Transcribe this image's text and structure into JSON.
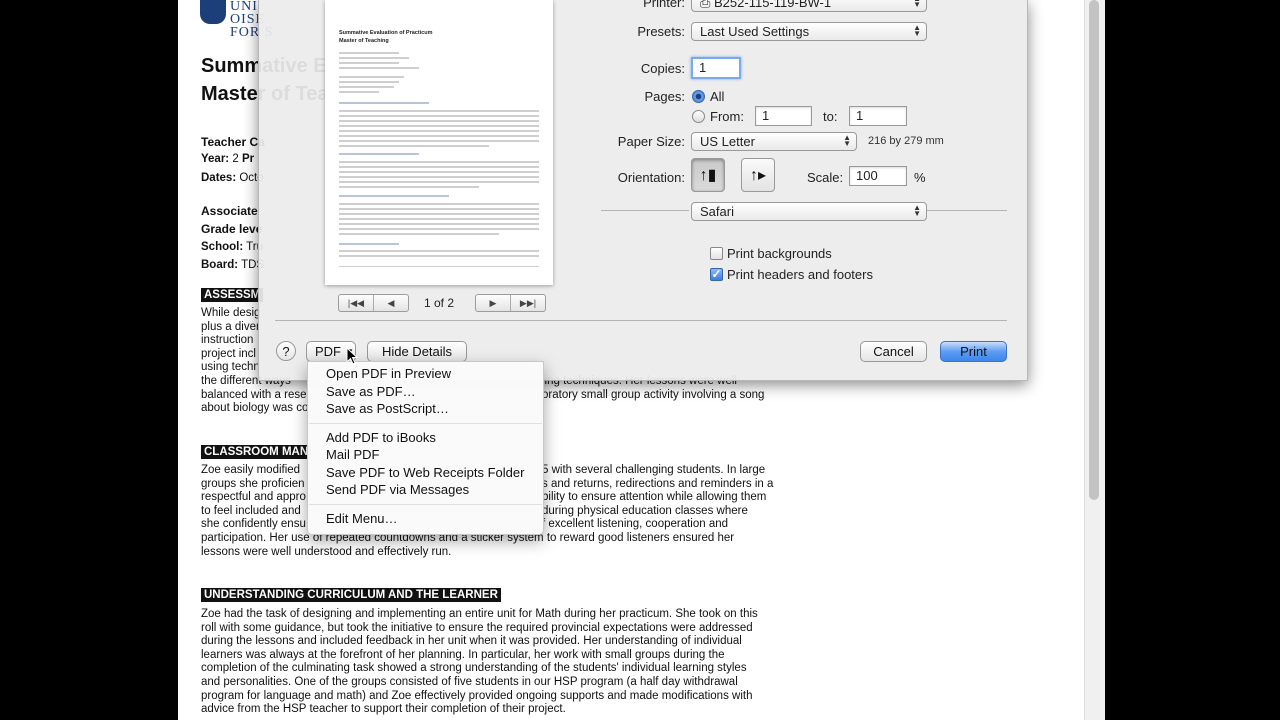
{
  "document": {
    "university_name_line1": "UNI",
    "university_name_line2": "OISE",
    "university_name_line3": "FOR S",
    "title_line1": "Summative E",
    "title_line2": "Master of Tea",
    "teacher_candidate_label": "Teacher Ca",
    "year_label": "Year:",
    "year_value": "2",
    "year_practicum": "Pr",
    "dates_label": "Dates:",
    "dates_value": "Octo",
    "associate_label": "Associate",
    "grade_label": "Grade leve",
    "school_label": "School:",
    "school_value": "Tru",
    "board_label": "Board:",
    "board_value": "TDS",
    "section1_heading": "ASSESSM",
    "section1_para": [
      "While desig",
      "plus a diver",
      "instruction",
      "project incl",
      "using techn",
      "the different ways",
      "balanced with a rese",
      "about biology was co"
    ],
    "section1_right": [
      "",
      "",
      "",
      "",
      "",
      "ling techniques. Her lessons were well",
      "oratory small group activity involving a song",
      ""
    ],
    "section2_heading": "CLASSROOM MAN",
    "section2_para": [
      "Zoe easily modified",
      "groups she proficien",
      "respectful and appro",
      "to feel included and",
      "she confidently ensu",
      "participation. Her use of repeated countdowns and a sticker system to reward good listeners ensured her",
      "lessons were well understood and effectively run."
    ],
    "section2_right": [
      "5 with several challenging students. In large",
      "s and returns, redirections and reminders in a",
      "bility to ensure attention while allowing them",
      "during physical education classes where",
      "f excellent listening, cooperation and",
      "",
      ""
    ],
    "section3_heading": "UNDERSTANDING CURRICULUM AND THE LEARNER",
    "section3_para": [
      "Zoe had the task of designing and implementing an entire unit for Math during her practicum. She took on this",
      "roll with some guidance, but took the initiative to ensure the required provincial expectations were addressed",
      "during the lessons and included feedback in her unit when it was provided. Her understanding of individual",
      "learners was always at the forefront of her planning. In particular, her work with small groups during the",
      "completion of the culminating task showed a strong understanding of the students' individual learning styles",
      "and personalities. One of the groups consisted of five students in our HSP program (a half day withdrawal",
      "program for language and math) and Zoe effectively provided ongoing supports and made modifications with",
      "advice from the HSP teacher to support their completion of their project."
    ]
  },
  "preview": {
    "mini_title1": "Summative Evaluation of Practicum",
    "mini_title2": "Master of Teaching",
    "page_count": "1 of 2"
  },
  "print_dialog": {
    "printer_label": "Printer:",
    "printer_value": "B252-115-119-BW-1",
    "presets_label": "Presets:",
    "presets_value": "Last Used Settings",
    "copies_label": "Copies:",
    "copies_value": "1",
    "pages_label": "Pages:",
    "pages_all": "All",
    "pages_from": "From:",
    "pages_from_value": "1",
    "pages_to": "to:",
    "pages_to_value": "1",
    "paper_size_label": "Paper Size:",
    "paper_size_value": "US Letter",
    "paper_dims": "216 by 279 mm",
    "orientation_label": "Orientation:",
    "scale_label": "Scale:",
    "scale_value": "100",
    "scale_unit": "%",
    "app_section": "Safari",
    "print_backgrounds": "Print backgrounds",
    "print_headers_footers": "Print headers and footers",
    "help_label": "?",
    "pdf_label": "PDF",
    "hide_details": "Hide Details",
    "cancel": "Cancel",
    "print": "Print"
  },
  "pdf_menu": {
    "items_group1": [
      "Open PDF in Preview",
      "Save as PDF…",
      "Save as PostScript…"
    ],
    "items_group2": [
      "Add PDF to iBooks",
      "Mail PDF",
      "Save PDF to Web Receipts Folder",
      "Send PDF via Messages"
    ],
    "items_group3": [
      "Edit Menu…"
    ]
  }
}
